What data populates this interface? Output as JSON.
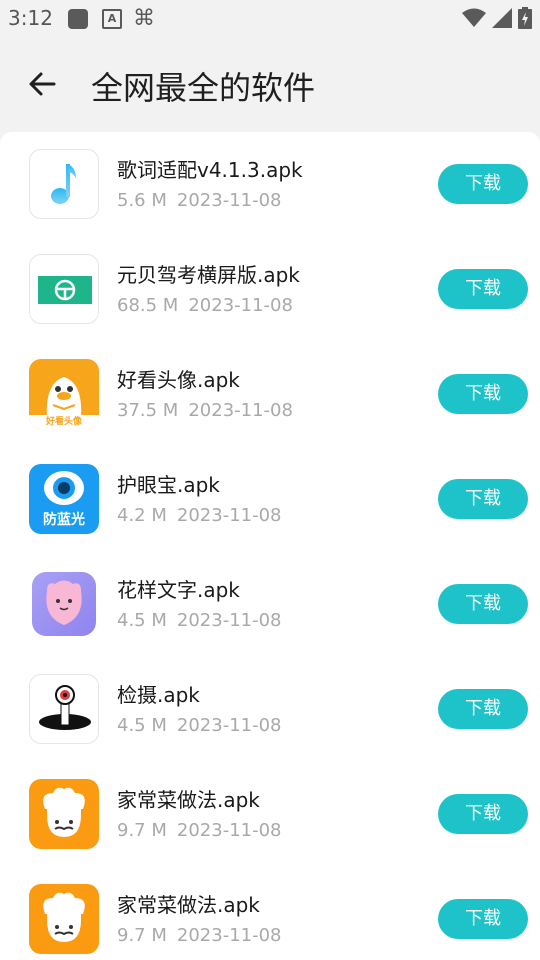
{
  "status_bar": {
    "time": "3:12",
    "icons": [
      "app-square-icon",
      "a-box-icon",
      "bug-icon"
    ],
    "right_icons": [
      "wifi-icon",
      "signal-icon",
      "battery-charging-icon"
    ]
  },
  "header": {
    "title": "全网最全的软件",
    "back_icon": "arrow-left-icon"
  },
  "colors": {
    "accent": "#1ec3c9",
    "background": "#f2f2f2",
    "meta_text": "#a9a9a9"
  },
  "download_label": "下载",
  "apps": [
    {
      "name": "歌词适配v4.1.3.apk",
      "size": "5.6 M",
      "date": "2023-11-08",
      "icon": "music-note-icon"
    },
    {
      "name": "元贝驾考横屏版.apk",
      "size": "68.5 M",
      "date": "2023-11-08",
      "icon": "steering-wheel-icon"
    },
    {
      "name": "好看头像.apk",
      "size": "37.5 M",
      "date": "2023-11-08",
      "icon": "duck-avatar-icon",
      "icon_text": "好看头像"
    },
    {
      "name": "护眼宝.apk",
      "size": "4.2 M",
      "date": "2023-11-08",
      "icon": "eye-icon",
      "icon_text": "防蓝光"
    },
    {
      "name": "花样文字.apk",
      "size": "4.5 M",
      "date": "2023-11-08",
      "icon": "flower-face-icon"
    },
    {
      "name": "检摄.apk",
      "size": "4.5 M",
      "date": "2023-11-08",
      "icon": "camera-scope-icon"
    },
    {
      "name": "家常菜做法.apk",
      "size": "9.7 M",
      "date": "2023-11-08",
      "icon": "chef-icon"
    },
    {
      "name": "家常菜做法.apk",
      "size": "9.7 M",
      "date": "2023-11-08",
      "icon": "chef-icon"
    }
  ]
}
